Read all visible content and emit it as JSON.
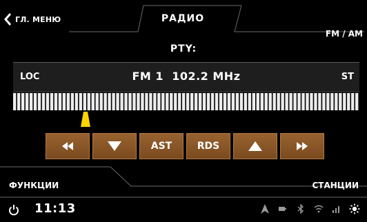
{
  "header": {
    "back_label": "ГЛ. МЕНЮ",
    "title": "РАДИО",
    "band_label": "FM / AM"
  },
  "pty_label": "PTY:",
  "frequency_panel": {
    "loc_label": "LOC",
    "frequency": "FM 1  102.2 MHz",
    "stereo_label": "ST"
  },
  "tuning_scale": {
    "marker_position_fraction": 0.21,
    "marker_color": "#ffd400"
  },
  "controls": {
    "seek_back_icon": "double-left-arrow",
    "tune_down_icon": "triangle-down",
    "ast_label": "AST",
    "rds_label": "RDS",
    "tune_up_icon": "triangle-up",
    "seek_forward_icon": "double-right-arrow",
    "button_color": "#8c5a2c"
  },
  "footer": {
    "functions_label": "ФУНКЦИИ",
    "stations_label": "СТАНЦИИ"
  },
  "statusbar": {
    "time": "11:13",
    "icons": [
      "navigation-icon",
      "battery-icon",
      "bluetooth-icon",
      "wifi-icon",
      "signal-icon",
      "brightness-icon"
    ]
  }
}
